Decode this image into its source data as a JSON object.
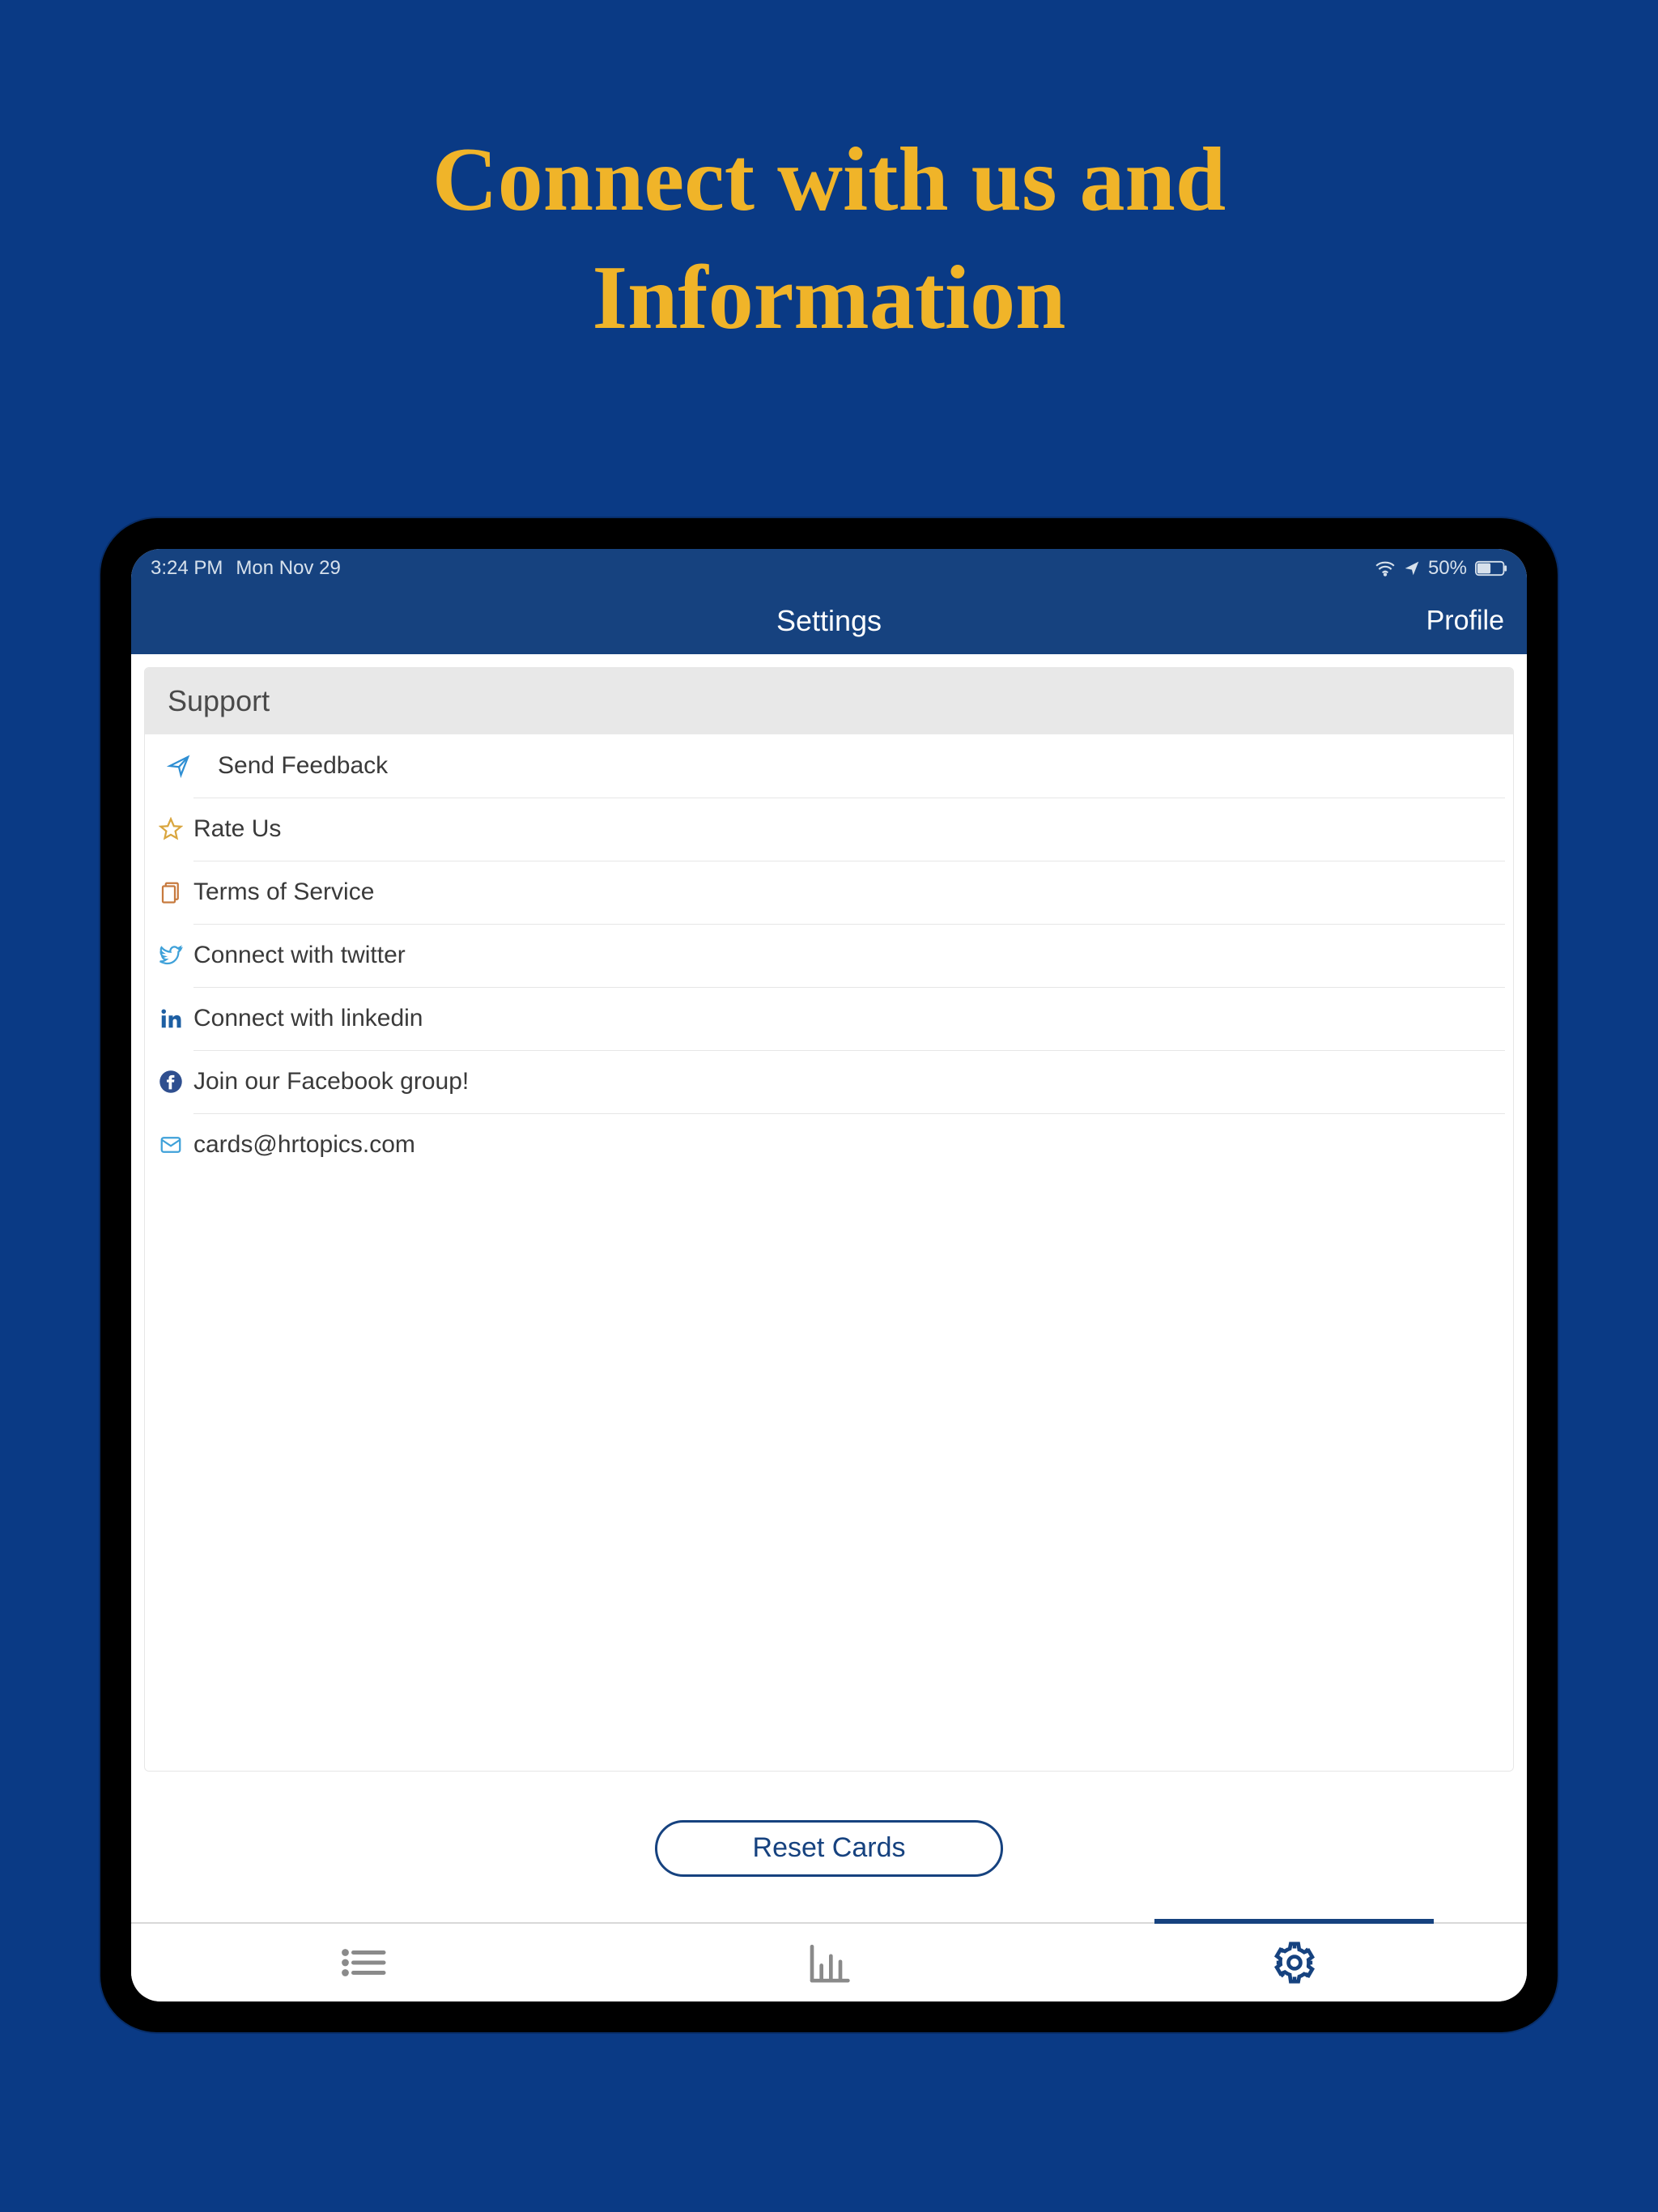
{
  "hero": {
    "line1": "Connect with us and",
    "line2": "Information"
  },
  "status_bar": {
    "time": "3:24 PM",
    "date": "Mon Nov 29",
    "battery_pct": "50%"
  },
  "nav": {
    "title": "Settings",
    "right_action": "Profile"
  },
  "section": {
    "header": "Support",
    "rows": [
      {
        "label": "Send Feedback"
      },
      {
        "label": "Rate Us"
      },
      {
        "label": "Terms of Service"
      },
      {
        "label": "Connect with twitter"
      },
      {
        "label": "Connect with linkedin"
      },
      {
        "label": "Join our Facebook group!"
      },
      {
        "label": "cards@hrtopics.com"
      }
    ]
  },
  "reset_button": "Reset Cards"
}
